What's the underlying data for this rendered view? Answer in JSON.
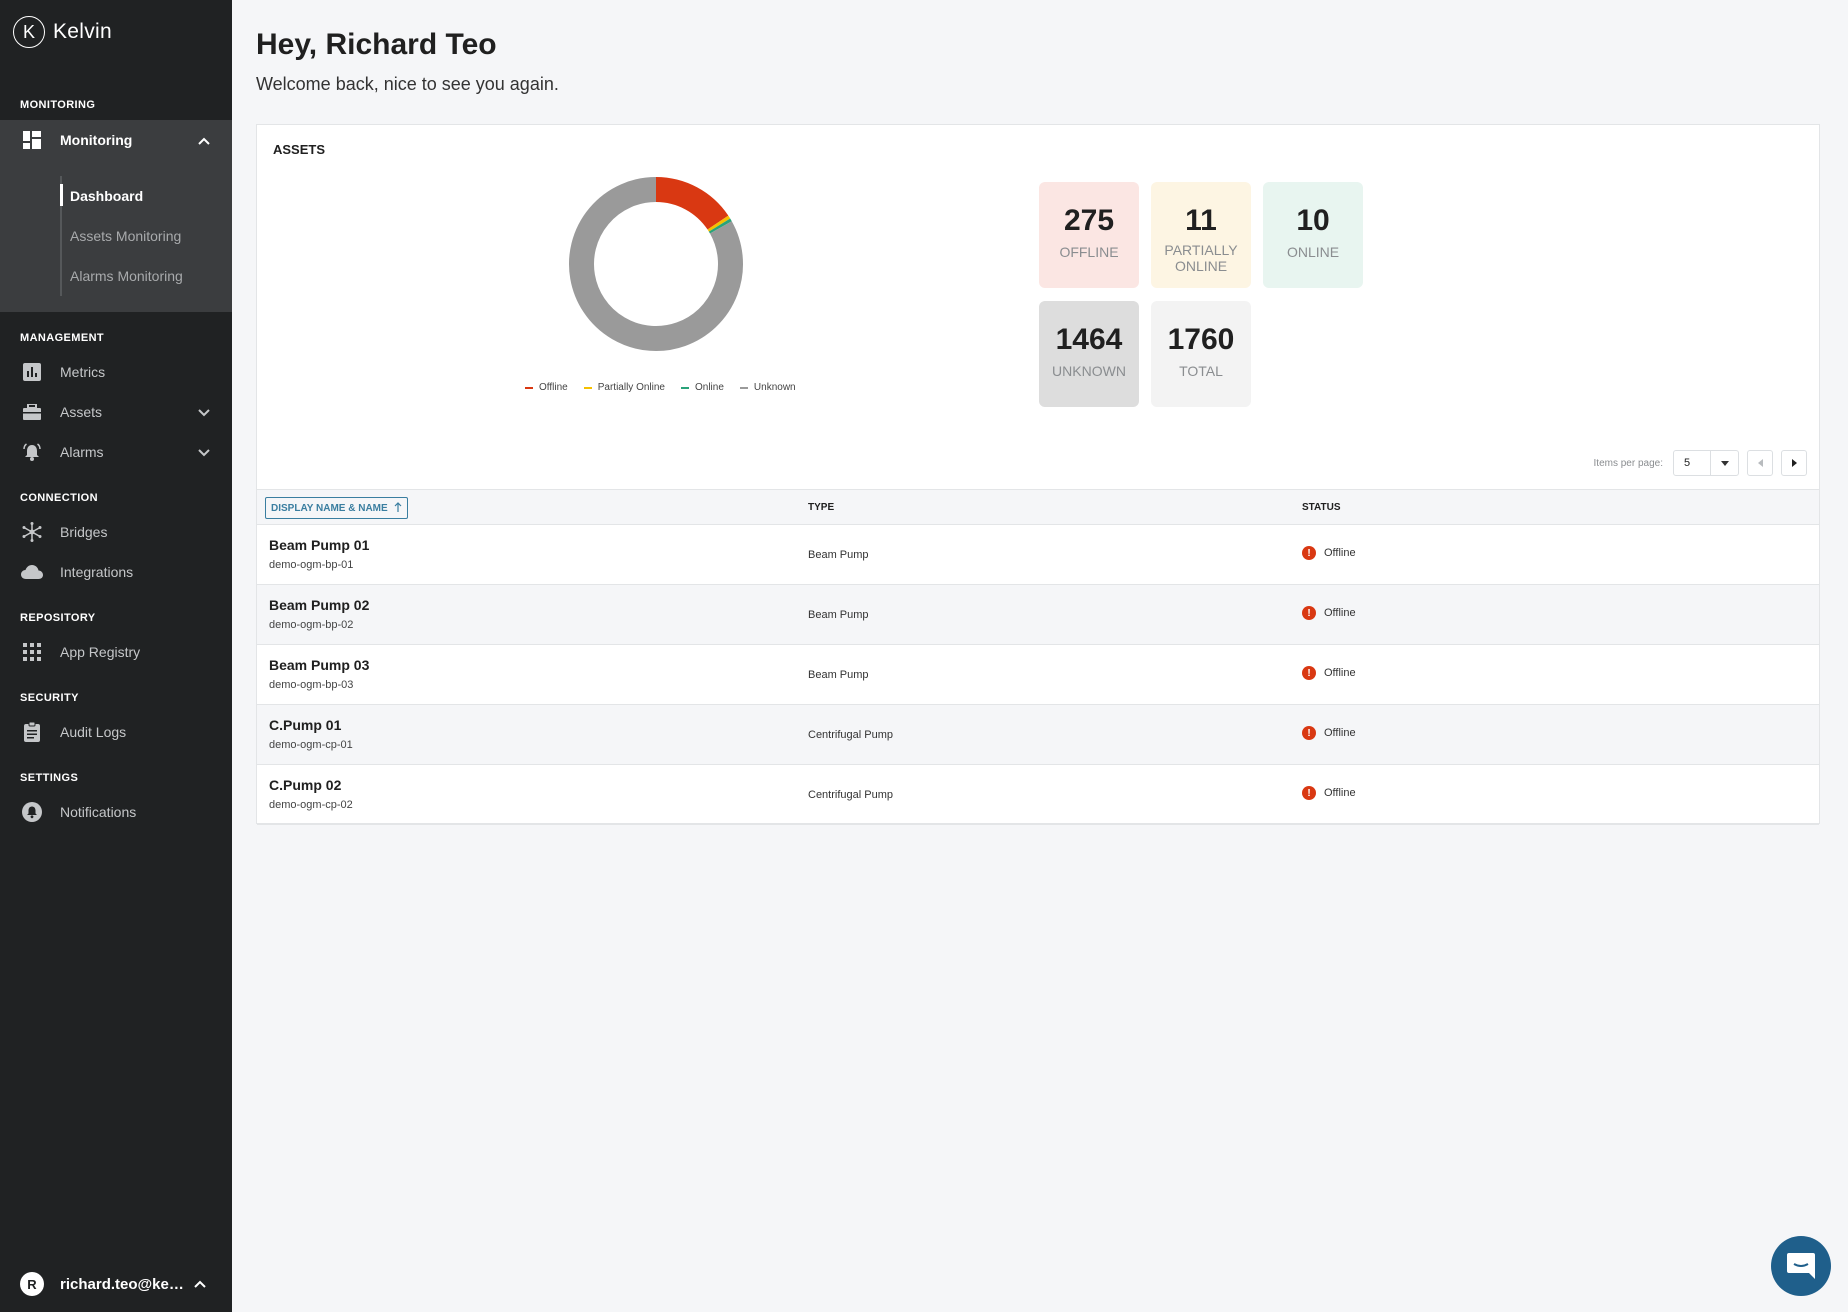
{
  "app": {
    "brand": "Kelvin",
    "brand_initial": "K"
  },
  "sidebar": {
    "sections": {
      "monitoring": "MONITORING",
      "management": "MANAGEMENT",
      "connection": "CONNECTION",
      "repository": "REPOSITORY",
      "security": "SECURITY",
      "settings": "SETTINGS"
    },
    "monitoring": {
      "label": "Monitoring",
      "expanded": true,
      "sub": [
        "Dashboard",
        "Assets Monitoring",
        "Alarms Monitoring"
      ],
      "active_sub": "Dashboard"
    },
    "metrics": "Metrics",
    "assets": "Assets",
    "alarms": "Alarms",
    "bridges": "Bridges",
    "integrations": "Integrations",
    "app_registry": "App Registry",
    "audit_logs": "Audit Logs",
    "notifications": "Notifications",
    "user": {
      "initial": "R",
      "email": "richard.teo@kel..."
    }
  },
  "header": {
    "greeting": "Hey, Richard Teo",
    "subtitle": "Welcome back, nice to see you again."
  },
  "assets_card": {
    "title": "ASSETS",
    "stats": {
      "offline": {
        "value": "275",
        "label": "OFFLINE"
      },
      "partially_online": {
        "value": "11",
        "label": "PARTIALLY ONLINE"
      },
      "online": {
        "value": "10",
        "label": "ONLINE"
      },
      "unknown": {
        "value": "1464",
        "label": "UNKNOWN"
      },
      "total": {
        "value": "1760",
        "label": "TOTAL"
      }
    },
    "pager": {
      "items_per_page_label": "Items per page:",
      "items_per_page": "5"
    },
    "table": {
      "headers": {
        "name": "DISPLAY NAME & NAME",
        "type": "TYPE",
        "status": "STATUS"
      },
      "sort": "ascending",
      "rows": [
        {
          "display_name": "Beam Pump 01",
          "name": "demo-ogm-bp-01",
          "type": "Beam Pump",
          "status": "Offline"
        },
        {
          "display_name": "Beam Pump 02",
          "name": "demo-ogm-bp-02",
          "type": "Beam Pump",
          "status": "Offline"
        },
        {
          "display_name": "Beam Pump 03",
          "name": "demo-ogm-bp-03",
          "type": "Beam Pump",
          "status": "Offline"
        },
        {
          "display_name": "C.Pump 01",
          "name": "demo-ogm-cp-01",
          "type": "Centrifugal Pump",
          "status": "Offline"
        },
        {
          "display_name": "C.Pump 02",
          "name": "demo-ogm-cp-02",
          "type": "Centrifugal Pump",
          "status": "Offline"
        }
      ]
    }
  },
  "chart_data": {
    "type": "pie",
    "style": "donut",
    "categories": [
      "Offline",
      "Partially Online",
      "Online",
      "Unknown"
    ],
    "values": [
      275,
      11,
      10,
      1464
    ],
    "colors": [
      "#d93812",
      "#f5c000",
      "#2aa37a",
      "#9a9a9a"
    ],
    "legend_placement": "bottom"
  },
  "colors": {
    "sidebar_bg": "#202223",
    "offline": "#d93812",
    "accent": "#3a7ea0",
    "chat": "#1f5f8b"
  }
}
